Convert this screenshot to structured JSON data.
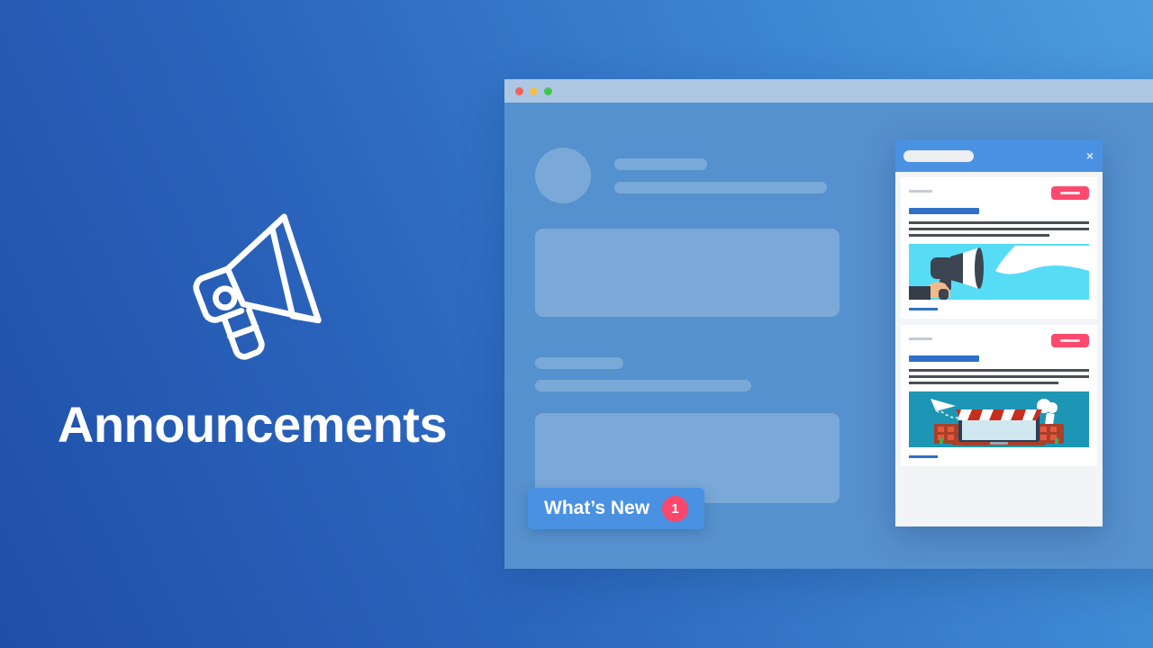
{
  "hero": {
    "title": "Announcements",
    "icon": "megaphone-icon"
  },
  "colors": {
    "bg_gradient_start": "#1f4fa8",
    "bg_gradient_end": "#4c9ce0",
    "accent_blue": "#4a91e2",
    "badge_pink": "#f9486b",
    "card_badge_pink": "#fb4a6d",
    "titlebar": "#adc7e2",
    "window_body": "#5591ce",
    "card_art_1_bg": "#56dcf5",
    "card_art_2_bg": "#1d96b5"
  },
  "browser": {
    "titlebar": {
      "dots": [
        "close-red",
        "minimize-amber",
        "maximize-green"
      ]
    }
  },
  "whats_new_button": {
    "label": "What’s New",
    "badge_count": "1"
  },
  "popup": {
    "header": {
      "close_icon": "×",
      "title_placeholder": ""
    },
    "cards": [
      {
        "date_placeholder": "",
        "badge_label": "",
        "title_placeholder": "",
        "body_lines": 3,
        "artwork": "hand-megaphone-speech-bubble",
        "link_placeholder": ""
      },
      {
        "date_placeholder": "",
        "badge_label": "",
        "title_placeholder": "",
        "body_lines": 3,
        "artwork": "ecommerce-storefront-laptop",
        "link_placeholder": ""
      }
    ]
  }
}
